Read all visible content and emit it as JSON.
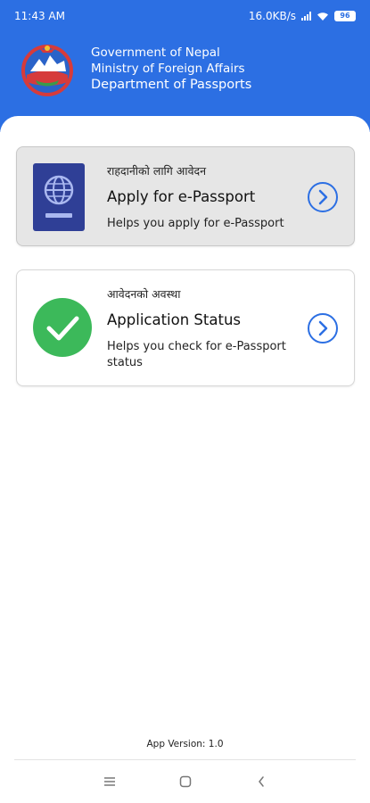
{
  "status_bar": {
    "time": "11:43 AM",
    "network_speed": "16.0KB/s",
    "battery": "96"
  },
  "header": {
    "line1": "Government of Nepal",
    "line2": "Ministry of Foreign Affairs",
    "line3": "Department of Passports",
    "emblem_icon": "nepal-emblem-icon",
    "background_color": "#2c6fe3"
  },
  "cards": [
    {
      "subtitle": "राहदानीको लागि आवेदन",
      "title": "Apply for e-Passport",
      "description": "Helps you apply for e-Passport",
      "icon": "passport-icon"
    },
    {
      "subtitle": "आवेदनको अवस्था",
      "title": "Application Status",
      "description": "Helps you check for e-Passport status",
      "icon": "check-circle-icon"
    }
  ],
  "footer": {
    "app_version": "App Version: 1.0"
  },
  "colors": {
    "accent": "#2c6fe3",
    "passport_blue": "#2f3f96",
    "success_green": "#3cb95a"
  }
}
